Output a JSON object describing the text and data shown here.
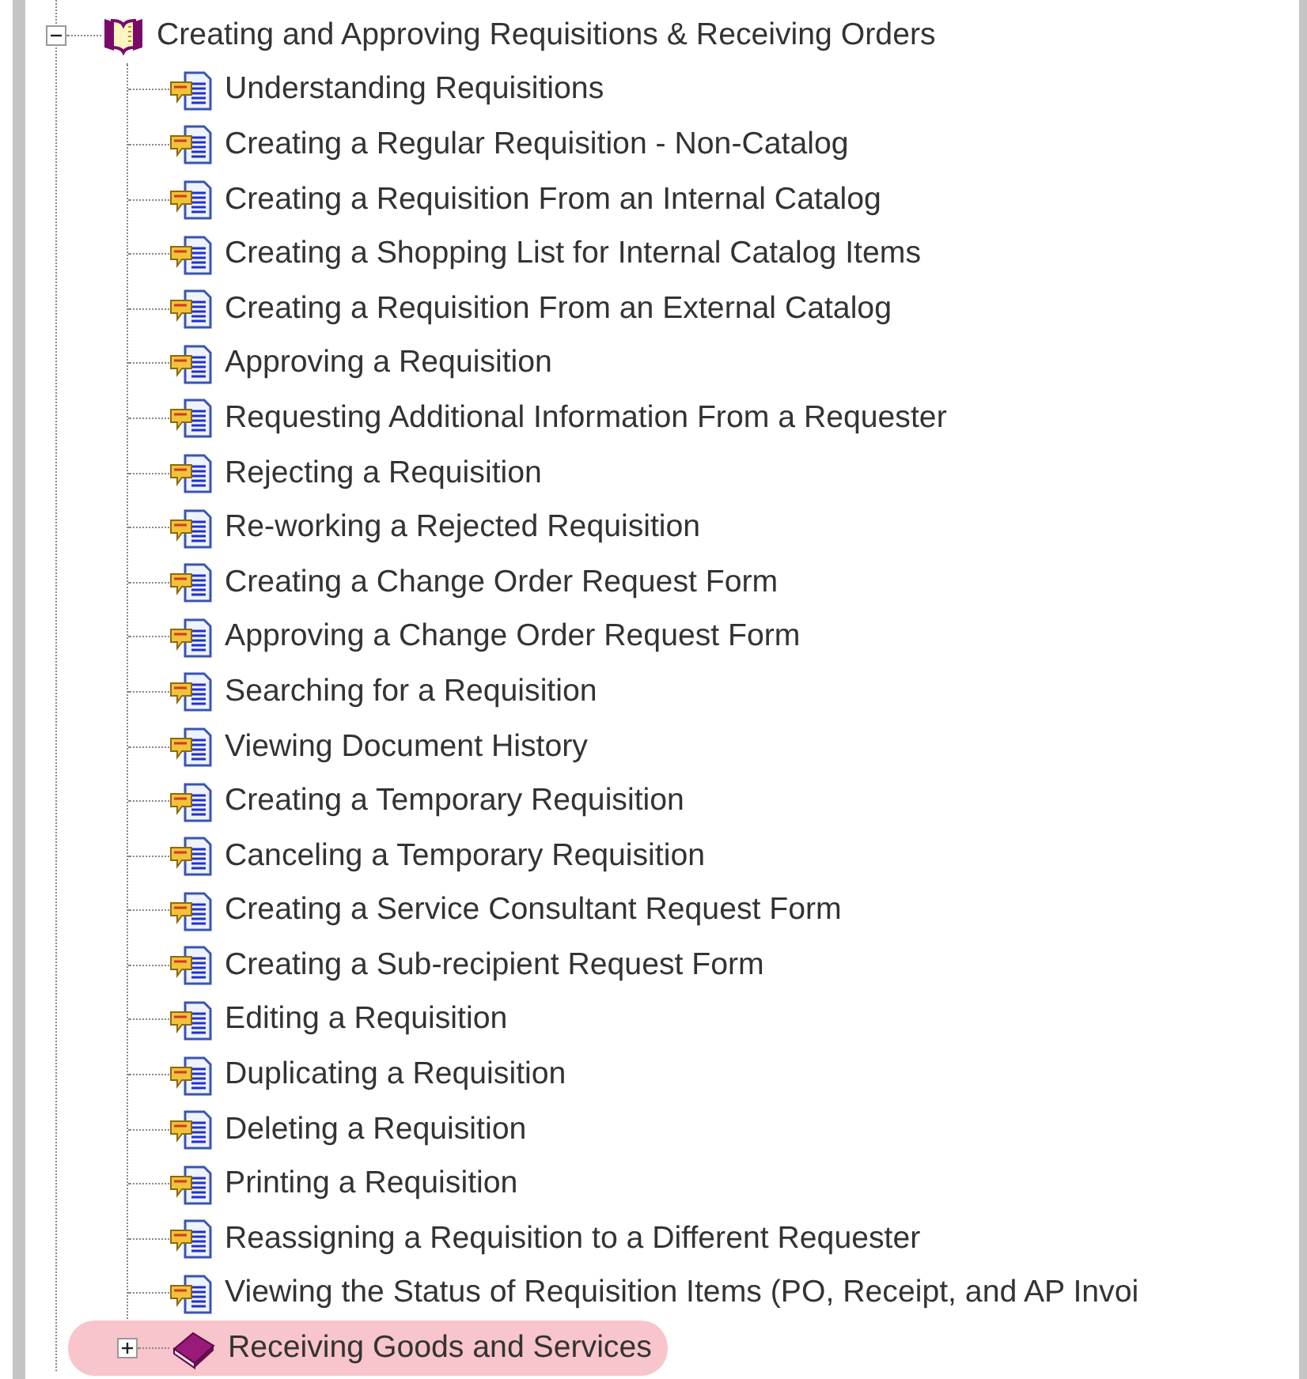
{
  "tree": [
    {
      "kind": "book",
      "label": "Creating and Approving Requisitions & Receiving Orders",
      "expanded": true,
      "selected": false,
      "children": [
        {
          "kind": "topic",
          "label": "Understanding Requisitions",
          "selected": false
        },
        {
          "kind": "topic",
          "label": "Creating a Regular Requisition - Non-Catalog",
          "selected": false
        },
        {
          "kind": "topic",
          "label": "Creating a Requisition From an Internal Catalog",
          "selected": false
        },
        {
          "kind": "topic",
          "label": "Creating a Shopping List for Internal Catalog Items",
          "selected": false
        },
        {
          "kind": "topic",
          "label": "Creating a Requisition From an External Catalog",
          "selected": false
        },
        {
          "kind": "topic",
          "label": "Approving a Requisition",
          "selected": false
        },
        {
          "kind": "topic",
          "label": "Requesting Additional Information From a Requester",
          "selected": false
        },
        {
          "kind": "topic",
          "label": "Rejecting a Requisition",
          "selected": false
        },
        {
          "kind": "topic",
          "label": "Re-working a Rejected Requisition",
          "selected": false
        },
        {
          "kind": "topic",
          "label": "Creating a Change Order Request Form",
          "selected": false
        },
        {
          "kind": "topic",
          "label": "Approving a Change Order Request Form",
          "selected": false
        },
        {
          "kind": "topic",
          "label": "Searching for a Requisition",
          "selected": false
        },
        {
          "kind": "topic",
          "label": "Viewing Document History",
          "selected": false
        },
        {
          "kind": "topic",
          "label": "Creating a Temporary Requisition",
          "selected": false
        },
        {
          "kind": "topic",
          "label": "Canceling a Temporary Requisition",
          "selected": false
        },
        {
          "kind": "topic",
          "label": "Creating a Service Consultant Request Form",
          "selected": false
        },
        {
          "kind": "topic",
          "label": "Creating a Sub-recipient Request Form",
          "selected": false
        },
        {
          "kind": "topic",
          "label": "Editing a Requisition",
          "selected": false
        },
        {
          "kind": "topic",
          "label": "Duplicating a Requisition",
          "selected": false
        },
        {
          "kind": "topic",
          "label": "Deleting a Requisition",
          "selected": false
        },
        {
          "kind": "topic",
          "label": "Printing a Requisition",
          "selected": false
        },
        {
          "kind": "topic",
          "label": "Reassigning a Requisition to a Different Requester",
          "selected": false
        },
        {
          "kind": "topic",
          "label": "Viewing the Status of Requisition Items (PO, Receipt, and AP Invoi",
          "selected": false
        },
        {
          "kind": "book",
          "label": "Receiving Goods and Services",
          "expanded": false,
          "selected": true
        }
      ]
    }
  ]
}
